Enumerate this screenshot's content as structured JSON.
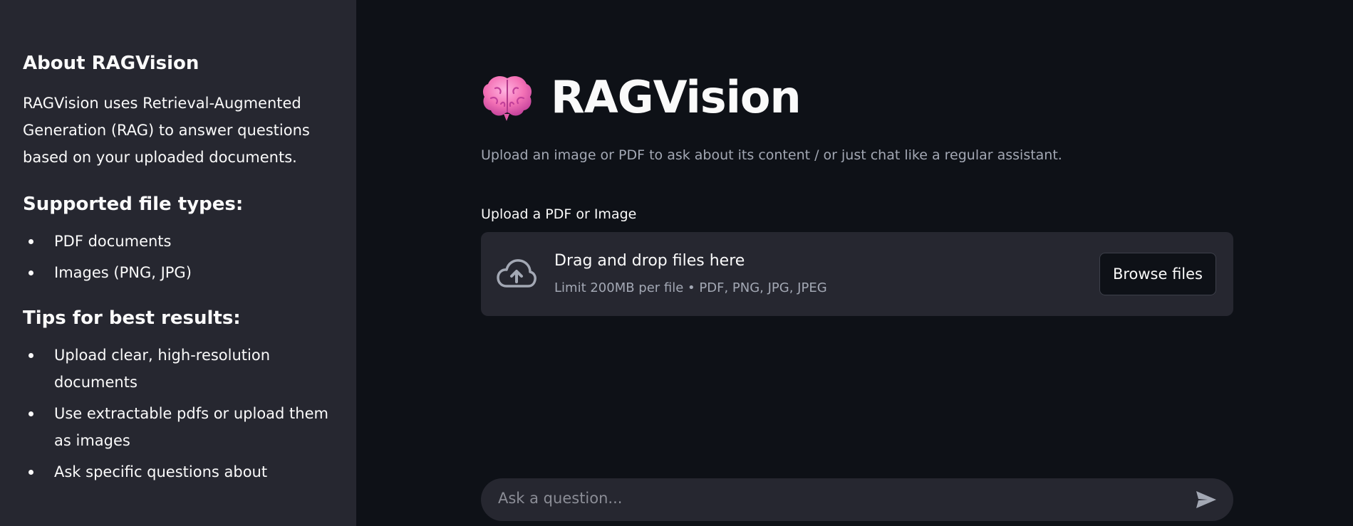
{
  "sidebar": {
    "about_heading": "About RAGVision",
    "about_text": "RAGVision uses Retrieval-Augmented Generation (RAG) to answer questions based on your uploaded documents.",
    "supported_heading": "Supported file types:",
    "supported_items": [
      "PDF documents",
      "Images (PNG, JPG)"
    ],
    "tips_heading": "Tips for best results:",
    "tips_items": [
      "Upload clear, high-resolution documents",
      "Use extractable pdfs or upload them as images",
      "Ask specific questions about"
    ]
  },
  "main": {
    "title": "RAGVision",
    "title_icon": "brain-icon",
    "subtitle": "Upload an image or PDF to ask about its content / or just chat like a regular assistant.",
    "upload_label": "Upload a PDF or Image",
    "dropzone": {
      "icon": "cloud-upload-icon",
      "title": "Drag and drop files here",
      "limit": "Limit 200MB per file • PDF, PNG, JPG, JPEG",
      "browse_label": "Browse files"
    },
    "chat": {
      "placeholder": "Ask a question...",
      "send_icon": "send-icon"
    }
  },
  "colors": {
    "background": "#0e1117",
    "sidebar": "#262730",
    "text": "#fafafa",
    "muted": "#a3a8b4",
    "brain": "#f472b6"
  }
}
